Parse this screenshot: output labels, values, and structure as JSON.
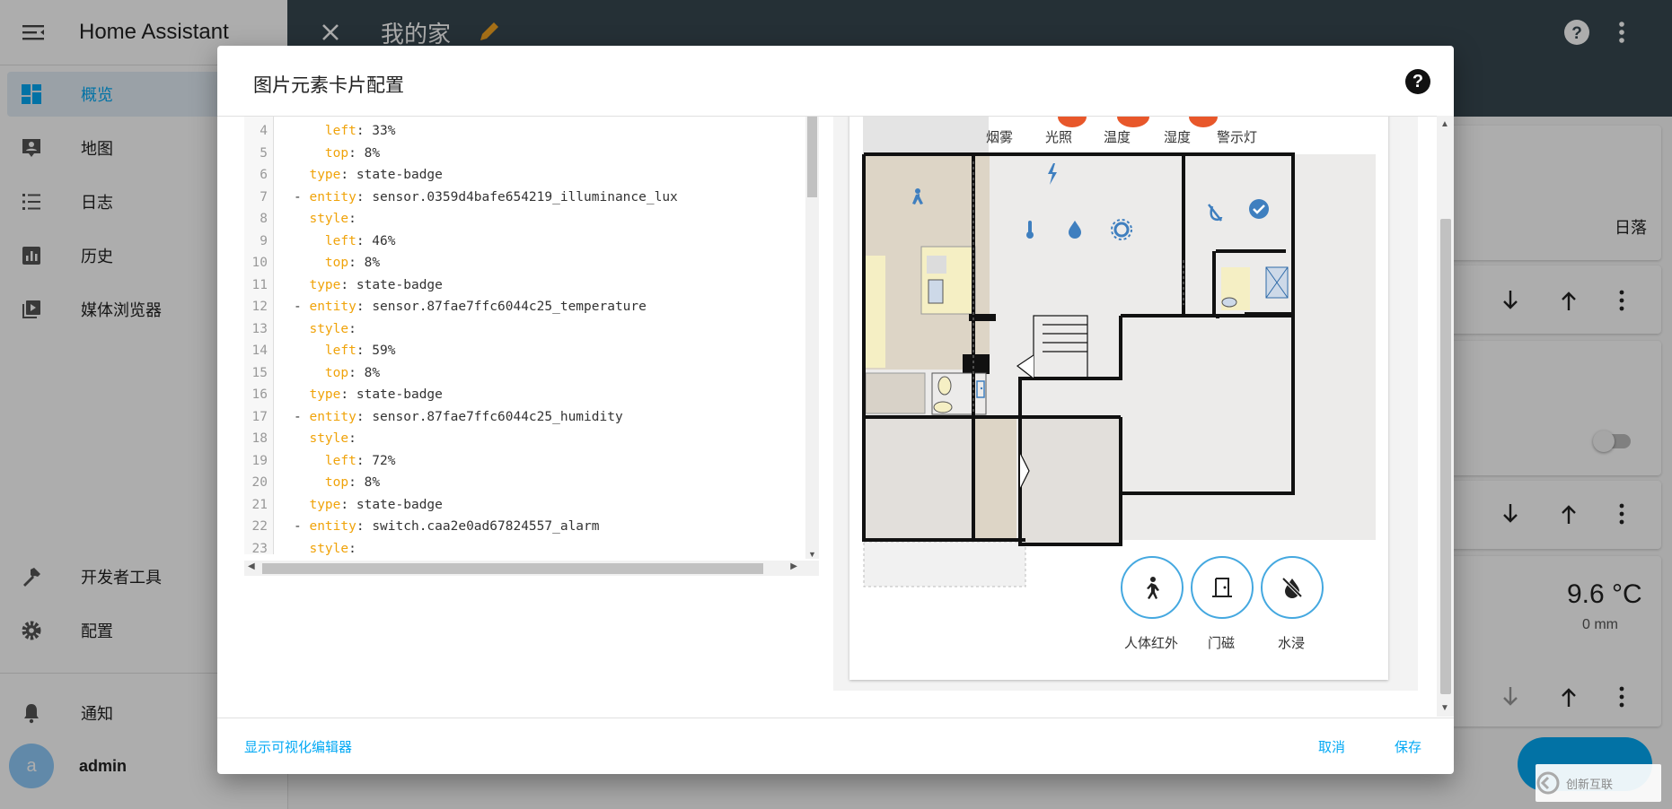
{
  "app": {
    "title": "Home Assistant",
    "sidebar": {
      "items": [
        {
          "label": "概览",
          "icon": "dashboard-icon"
        },
        {
          "label": "地图",
          "icon": "map-account-icon"
        },
        {
          "label": "日志",
          "icon": "logbook-list-icon"
        },
        {
          "label": "历史",
          "icon": "history-chart-icon"
        },
        {
          "label": "媒体浏览器",
          "icon": "media-play-icon"
        }
      ],
      "dev_tools": "开发者工具",
      "config": "配置",
      "notifications": "通知",
      "user": {
        "initial": "a",
        "name": "admin"
      }
    },
    "topbar": {
      "title": "我的家"
    },
    "background": {
      "sunset": "日落",
      "temperature": "9.6 °C",
      "rain": "0 mm"
    }
  },
  "dialog": {
    "title": "图片元素卡片配置",
    "show_visual_editor": "显示可视化编辑器",
    "cancel": "取消",
    "save": "保存",
    "code_lines": [
      {
        "n": "4",
        "indent": "    ",
        "key": "left",
        "val": " 33%"
      },
      {
        "n": "5",
        "indent": "    ",
        "key": "top",
        "val": " 8%"
      },
      {
        "n": "6",
        "indent": "  ",
        "key": "type",
        "val": " state-badge"
      },
      {
        "n": "7",
        "indent": "- ",
        "key": "entity",
        "val": " sensor.0359d4bafe654219_illuminance_lux"
      },
      {
        "n": "8",
        "indent": "  ",
        "key": "style",
        "val": ""
      },
      {
        "n": "9",
        "indent": "    ",
        "key": "left",
        "val": " 46%"
      },
      {
        "n": "10",
        "indent": "    ",
        "key": "top",
        "val": " 8%"
      },
      {
        "n": "11",
        "indent": "  ",
        "key": "type",
        "val": " state-badge"
      },
      {
        "n": "12",
        "indent": "- ",
        "key": "entity",
        "val": " sensor.87fae7ffc6044c25_temperature"
      },
      {
        "n": "13",
        "indent": "  ",
        "key": "style",
        "val": ""
      },
      {
        "n": "14",
        "indent": "    ",
        "key": "left",
        "val": " 59%"
      },
      {
        "n": "15",
        "indent": "    ",
        "key": "top",
        "val": " 8%"
      },
      {
        "n": "16",
        "indent": "  ",
        "key": "type",
        "val": " state-badge"
      },
      {
        "n": "17",
        "indent": "- ",
        "key": "entity",
        "val": " sensor.87fae7ffc6044c25_humidity"
      },
      {
        "n": "18",
        "indent": "  ",
        "key": "style",
        "val": ""
      },
      {
        "n": "19",
        "indent": "    ",
        "key": "left",
        "val": " 72%"
      },
      {
        "n": "20",
        "indent": "    ",
        "key": "top",
        "val": " 8%"
      },
      {
        "n": "21",
        "indent": "  ",
        "key": "type",
        "val": " state-badge"
      },
      {
        "n": "22",
        "indent": "- ",
        "key": "entity",
        "val": " switch.caa2e0ad67824557_alarm"
      },
      {
        "n": "23",
        "indent": "  ",
        "key": "style",
        "val": ""
      }
    ],
    "preview": {
      "badges": [
        "烟雾",
        "光照",
        "温度",
        "湿度",
        "警示灯"
      ],
      "buttons": [
        "人体红外",
        "门磁",
        "水浸"
      ]
    }
  },
  "watermark": "创新互联",
  "colors": {
    "accent": "#03a9f4",
    "header": "#374850",
    "yaml_key": "#f0a30a",
    "icon_blue": "#3f7fbf"
  }
}
